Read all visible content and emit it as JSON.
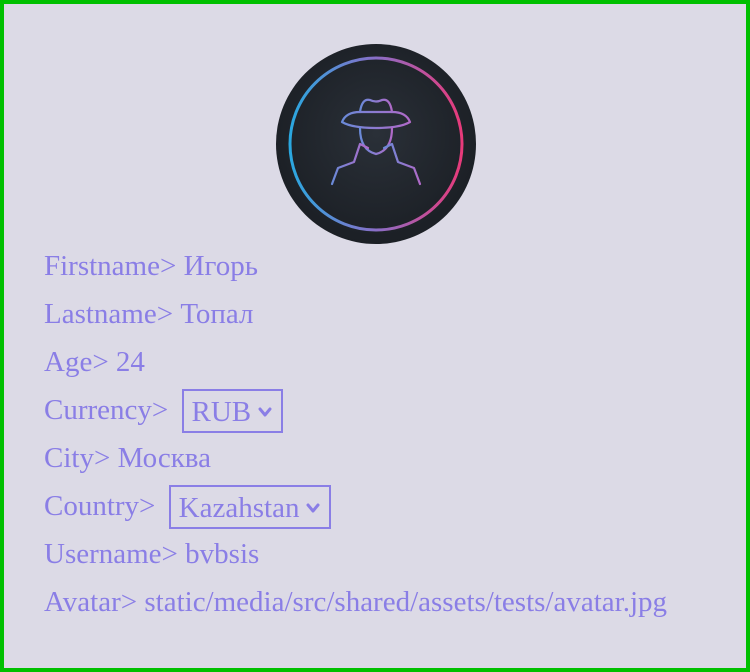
{
  "profile": {
    "avatar_icon": "incognito-spy-icon",
    "colors": {
      "text": "#8a7ee6",
      "background": "#dcdae6",
      "border": "#00c000"
    },
    "firstname": {
      "label": "Firstname>",
      "value": "Игорь"
    },
    "lastname": {
      "label": "Lastname>",
      "value": "Топал"
    },
    "age": {
      "label": "Age>",
      "value": "24"
    },
    "currency": {
      "label": "Currency>",
      "selected": "RUB"
    },
    "city": {
      "label": "City>",
      "value": "Москва"
    },
    "country": {
      "label": "Country>",
      "selected": "Kazahstan"
    },
    "username": {
      "label": "Username>",
      "value": "bvbsis"
    },
    "avatar": {
      "label": "Avatar>",
      "value": "static/media/src/shared/assets/tests/avatar.jpg"
    }
  }
}
